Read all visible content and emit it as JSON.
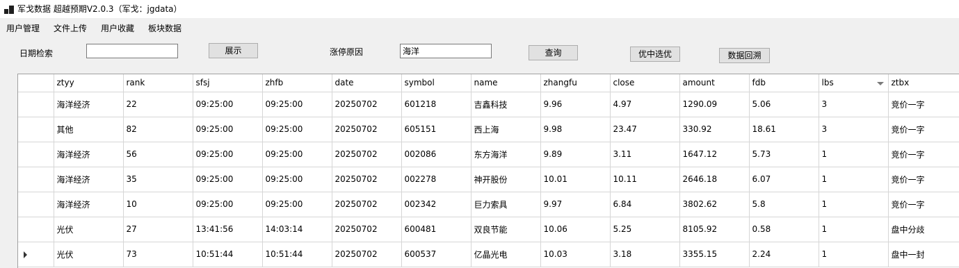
{
  "window": {
    "title": "军戈数据 超越预期V2.0.3（军戈：jgdata）"
  },
  "menu": [
    "用户管理",
    "文件上传",
    "用户收藏",
    "板块数据"
  ],
  "form": {
    "date_label": "日期检索",
    "date_value": "",
    "show_button": "展示",
    "reason_label": "涨停原因",
    "reason_value": "海洋",
    "query_button": "查询",
    "select_button": "优中选优",
    "backtrack_button": "数据回溯"
  },
  "table": {
    "columns": [
      "ztyy",
      "rank",
      "sfsj",
      "zhfb",
      "date",
      "symbol",
      "name",
      "zhangfu",
      "close",
      "amount",
      "fdb",
      "lbs",
      "ztbx"
    ],
    "sorted_column": "lbs",
    "current_row_index": 6,
    "rows": [
      [
        "海洋经济",
        "22",
        "09:25:00",
        "09:25:00",
        "20250702",
        "601218",
        "吉鑫科技",
        "9.96",
        "4.97",
        "1290.09",
        "5.06",
        "3",
        "竞价一字"
      ],
      [
        "其他",
        "82",
        "09:25:00",
        "09:25:00",
        "20250702",
        "605151",
        "西上海",
        "9.98",
        "23.47",
        "330.92",
        "18.61",
        "3",
        "竞价一字"
      ],
      [
        "海洋经济",
        "56",
        "09:25:00",
        "09:25:00",
        "20250702",
        "002086",
        "东方海洋",
        "9.89",
        "3.11",
        "1647.12",
        "5.73",
        "1",
        "竞价一字"
      ],
      [
        "海洋经济",
        "35",
        "09:25:00",
        "09:25:00",
        "20250702",
        "002278",
        "神开股份",
        "10.01",
        "10.11",
        "2646.18",
        "6.07",
        "1",
        "竞价一字"
      ],
      [
        "海洋经济",
        "10",
        "09:25:00",
        "09:25:00",
        "20250702",
        "002342",
        "巨力索具",
        "9.97",
        "6.84",
        "3802.62",
        "5.8",
        "1",
        "竞价一字"
      ],
      [
        "光伏",
        "27",
        "13:41:56",
        "14:03:14",
        "20250702",
        "600481",
        "双良节能",
        "10.06",
        "5.25",
        "8105.92",
        "0.58",
        "1",
        "盘中分歧"
      ],
      [
        "光伏",
        "73",
        "10:51:44",
        "10:51:44",
        "20250702",
        "600537",
        "亿晶光电",
        "10.03",
        "3.18",
        "3355.15",
        "2.24",
        "1",
        "盘中一封"
      ]
    ]
  }
}
